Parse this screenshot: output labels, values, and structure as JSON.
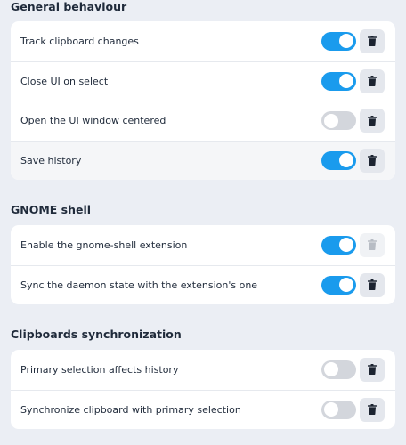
{
  "sections": [
    {
      "title": "General behaviour",
      "rows": [
        {
          "label": "Track clipboard changes",
          "on": true,
          "delete_enabled": true
        },
        {
          "label": "Close UI on select",
          "on": true,
          "delete_enabled": true
        },
        {
          "label": "Open the UI window centered",
          "on": false,
          "delete_enabled": true
        },
        {
          "label": "Save history",
          "on": true,
          "delete_enabled": true
        }
      ]
    },
    {
      "title": "GNOME shell",
      "rows": [
        {
          "label": "Enable the gnome-shell extension",
          "on": true,
          "delete_enabled": false
        },
        {
          "label": "Sync the daemon state with the extension's one",
          "on": true,
          "delete_enabled": true
        }
      ]
    },
    {
      "title": "Clipboards synchronization",
      "rows": [
        {
          "label": "Primary selection affects history",
          "on": false,
          "delete_enabled": true
        },
        {
          "label": "Synchronize clipboard with primary selection",
          "on": false,
          "delete_enabled": true
        }
      ]
    }
  ],
  "colors": {
    "toggle_on": "#1a9bed",
    "toggle_off": "#d3d6dc",
    "icon": "#1b2330",
    "icon_disabled": "#b7bcc4"
  },
  "icons": {
    "delete": "trash-icon"
  }
}
